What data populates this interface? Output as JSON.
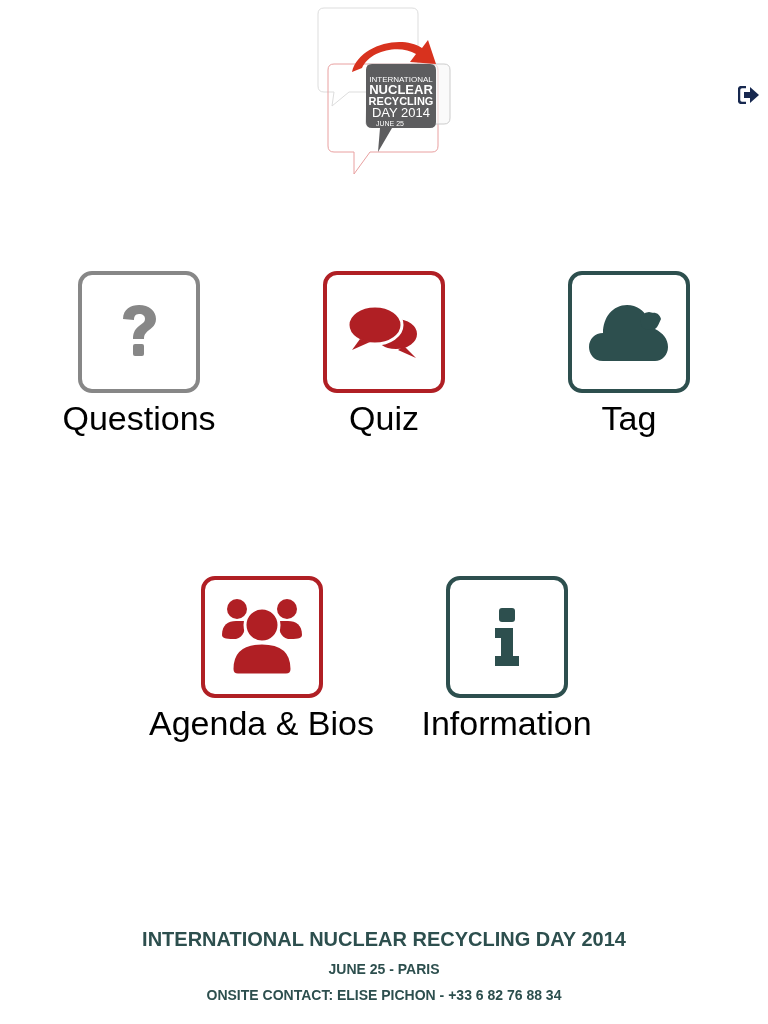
{
  "logo": {
    "lines": [
      "INTERNATIONAL",
      "NUCLEAR",
      "RECYCLING",
      "DAY 2014",
      "JUNE 25"
    ]
  },
  "tiles": [
    [
      {
        "label": "Questions",
        "kind": "question",
        "color": "#878787"
      },
      {
        "label": "Quiz",
        "kind": "chat",
        "color": "#b01f24"
      },
      {
        "label": "Tag",
        "kind": "cloud",
        "color": "#2d4f4e"
      }
    ],
    [
      {
        "label": "Agenda & Bios",
        "kind": "people",
        "color": "#b01f24"
      },
      {
        "label": "Information",
        "kind": "info",
        "color": "#2d4f4e"
      }
    ]
  ],
  "footer": {
    "title": "INTERNATIONAL NUCLEAR RECYCLING DAY 2014",
    "date": "JUNE 25 - PARIS",
    "contact": "ONSITE CONTACT: ELISE PICHON - +33 6 82 76 88 34"
  }
}
